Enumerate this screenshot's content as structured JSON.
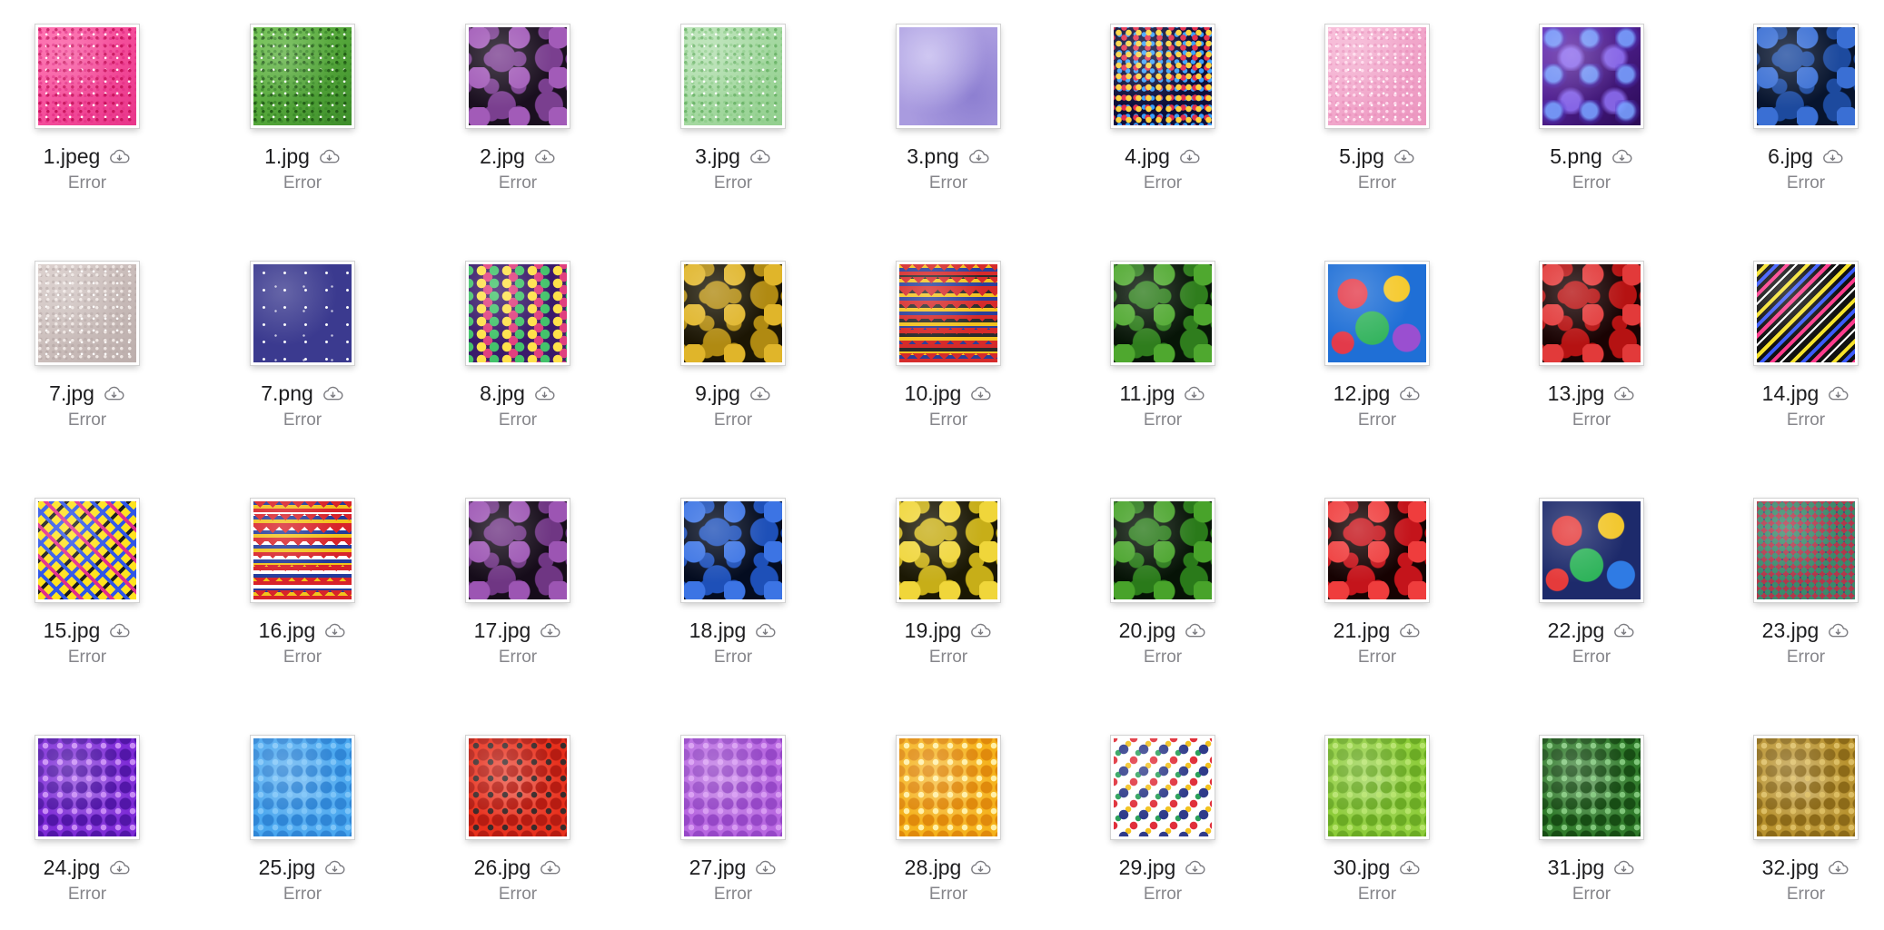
{
  "window": {
    "view": "icon-grid"
  },
  "files": [
    {
      "name": "1.jpeg",
      "status": "Error",
      "thumb": {
        "icon": "pink-glitter",
        "colors": [
          "#ff66aa",
          "#e8358a",
          "#c9155f"
        ],
        "pattern": "glitter"
      }
    },
    {
      "name": "1.jpg",
      "status": "Error",
      "thumb": {
        "icon": "green-glitter",
        "colors": [
          "#6bbf4a",
          "#3e8e2b",
          "#235f17"
        ],
        "pattern": "glitter"
      }
    },
    {
      "name": "2.jpg",
      "status": "Error",
      "thumb": {
        "icon": "purple-bokeh",
        "colors": [
          "#1a0f1f",
          "#7a3f8f",
          "#a25bb8"
        ],
        "pattern": "bokeh"
      }
    },
    {
      "name": "3.jpg",
      "status": "Error",
      "thumb": {
        "icon": "mint-glitter",
        "colors": [
          "#b9e3b6",
          "#92cf8e",
          "#6fb66c"
        ],
        "pattern": "glitter"
      }
    },
    {
      "name": "3.png",
      "status": "Error",
      "thumb": {
        "icon": "lavender-sky",
        "colors": [
          "#a99bdf",
          "#8d7fd1",
          "#c2b8ee"
        ],
        "pattern": "soft"
      }
    },
    {
      "name": "4.jpg",
      "status": "Error",
      "thumb": {
        "icon": "confetti-dots",
        "colors": [
          "#0d0f3b",
          "#ffd23c",
          "#e3304f",
          "#39a0ff"
        ],
        "pattern": "confetti"
      }
    },
    {
      "name": "5.jpg",
      "status": "Error",
      "thumb": {
        "icon": "light-pink-glitter",
        "colors": [
          "#f7b8d6",
          "#eb95bf",
          "#ffd7ea"
        ],
        "pattern": "glitter"
      }
    },
    {
      "name": "5.png",
      "status": "Error",
      "thumb": {
        "icon": "purple-bubbles",
        "colors": [
          "#2a0a55",
          "#6b2fb8",
          "#3e6bff"
        ],
        "pattern": "bubbles"
      }
    },
    {
      "name": "6.jpg",
      "status": "Error",
      "thumb": {
        "icon": "blue-bokeh",
        "colors": [
          "#07142e",
          "#1d4a9e",
          "#3a6fd4"
        ],
        "pattern": "bokeh"
      }
    },
    {
      "name": "7.jpg",
      "status": "Error",
      "thumb": {
        "icon": "silver-glitter",
        "colors": [
          "#d8ccc9",
          "#bcaeac",
          "#eee6e3"
        ],
        "pattern": "glitter"
      }
    },
    {
      "name": "7.png",
      "status": "Error",
      "thumb": {
        "icon": "night-stars",
        "colors": [
          "#3b3a8f",
          "#2d2c7a",
          "#ffffff"
        ],
        "pattern": "stars"
      }
    },
    {
      "name": "8.jpg",
      "status": "Error",
      "thumb": {
        "icon": "polka-dots",
        "colors": [
          "#3a1a6b",
          "#ffe14a",
          "#44c36b",
          "#e0407f"
        ],
        "pattern": "polka"
      }
    },
    {
      "name": "9.jpg",
      "status": "Error",
      "thumb": {
        "icon": "gold-bokeh",
        "colors": [
          "#1c1604",
          "#b08a12",
          "#e0b52a"
        ],
        "pattern": "bokeh"
      }
    },
    {
      "name": "10.jpg",
      "status": "Error",
      "thumb": {
        "icon": "zigzag-stripes",
        "colors": [
          "#d62b2b",
          "#2a3f9a",
          "#f3c21f",
          "#2b2b2b"
        ],
        "pattern": "zigzag"
      }
    },
    {
      "name": "11.jpg",
      "status": "Error",
      "thumb": {
        "icon": "green-bokeh",
        "colors": [
          "#071507",
          "#2f7d1d",
          "#4fa82f"
        ],
        "pattern": "bokeh"
      }
    },
    {
      "name": "12.jpg",
      "status": "Error",
      "thumb": {
        "icon": "rainbow-circles",
        "colors": [
          "#1f6fd6",
          "#e33a4a",
          "#f5c92b",
          "#35b45f",
          "#9a4fd0"
        ],
        "pattern": "circles"
      }
    },
    {
      "name": "13.jpg",
      "status": "Error",
      "thumb": {
        "icon": "red-bokeh",
        "colors": [
          "#1a0303",
          "#b51212",
          "#e23a3a"
        ],
        "pattern": "bokeh"
      }
    },
    {
      "name": "14.jpg",
      "status": "Error",
      "thumb": {
        "icon": "diagonal-stripes",
        "colors": [
          "#111111",
          "#f6e22b",
          "#3b5bff",
          "#ff3b8d",
          "#ffffff"
        ],
        "pattern": "diagonal"
      }
    },
    {
      "name": "15.jpg",
      "status": "Error",
      "thumb": {
        "icon": "plaid",
        "colors": [
          "#ffe31f",
          "#e02e8a",
          "#2f56e8",
          "#1b1b1b"
        ],
        "pattern": "plaid"
      }
    },
    {
      "name": "16.jpg",
      "status": "Error",
      "thumb": {
        "icon": "chevron-stripes",
        "colors": [
          "#d8232a",
          "#f2c21b",
          "#233b9c",
          "#ffffff"
        ],
        "pattern": "zigzag"
      }
    },
    {
      "name": "17.jpg",
      "status": "Error",
      "thumb": {
        "icon": "purple-bokeh",
        "colors": [
          "#160c1a",
          "#6f3683",
          "#9c55b3"
        ],
        "pattern": "bokeh"
      }
    },
    {
      "name": "18.jpg",
      "status": "Error",
      "thumb": {
        "icon": "blue-bokeh",
        "colors": [
          "#040c20",
          "#1e50b8",
          "#3c74e4"
        ],
        "pattern": "bokeh"
      }
    },
    {
      "name": "19.jpg",
      "status": "Error",
      "thumb": {
        "icon": "yellow-bokeh",
        "colors": [
          "#1b1804",
          "#c7ae18",
          "#f0d63a"
        ],
        "pattern": "bokeh"
      }
    },
    {
      "name": "20.jpg",
      "status": "Error",
      "thumb": {
        "icon": "green-bokeh",
        "colors": [
          "#061306",
          "#2a7a1a",
          "#48a32a"
        ],
        "pattern": "bokeh"
      }
    },
    {
      "name": "21.jpg",
      "status": "Error",
      "thumb": {
        "icon": "red-bokeh",
        "colors": [
          "#160202",
          "#c4141b",
          "#ef3d3d"
        ],
        "pattern": "bokeh"
      }
    },
    {
      "name": "22.jpg",
      "status": "Error",
      "thumb": {
        "icon": "rainbow-balls",
        "colors": [
          "#1d2a6b",
          "#e53b3b",
          "#f2c62a",
          "#2eb35a",
          "#2f7be4"
        ],
        "pattern": "circles"
      }
    },
    {
      "name": "23.jpg",
      "status": "Error",
      "thumb": {
        "icon": "multicolor-mosaic",
        "colors": [
          "#6b5a8c",
          "#3a8b6b",
          "#b3384a",
          "#2e3d8c",
          "#d9b03a"
        ],
        "pattern": "mosaic"
      }
    },
    {
      "name": "24.jpg",
      "status": "Error",
      "thumb": {
        "icon": "purple-hearts",
        "colors": [
          "#7d2bd6",
          "#5216a8",
          "#c78af5"
        ],
        "pattern": "tiles"
      }
    },
    {
      "name": "25.jpg",
      "status": "Error",
      "thumb": {
        "icon": "blue-hexagons",
        "colors": [
          "#4aa7ef",
          "#2f86d6",
          "#7cc4f8"
        ],
        "pattern": "tiles"
      }
    },
    {
      "name": "26.jpg",
      "status": "Error",
      "thumb": {
        "icon": "red-shoes",
        "colors": [
          "#e8301c",
          "#b61c12",
          "#3a2b2b"
        ],
        "pattern": "tiles"
      }
    },
    {
      "name": "27.jpg",
      "status": "Error",
      "thumb": {
        "icon": "violet-hexagons",
        "colors": [
          "#b767e0",
          "#9647c7",
          "#d79af2"
        ],
        "pattern": "tiles"
      }
    },
    {
      "name": "28.jpg",
      "status": "Error",
      "thumb": {
        "icon": "gold-bottles",
        "colors": [
          "#f5b21c",
          "#e08a0c",
          "#fff0a8"
        ],
        "pattern": "tiles"
      }
    },
    {
      "name": "29.jpg",
      "status": "Error",
      "thumb": {
        "icon": "colorful-figures",
        "colors": [
          "#ffffff",
          "#2f3b8a",
          "#e0303a",
          "#f3c21f",
          "#2aa05a"
        ],
        "pattern": "figures"
      }
    },
    {
      "name": "30.jpg",
      "status": "Error",
      "thumb": {
        "icon": "lime-hexagons",
        "colors": [
          "#8dcc3a",
          "#6bab24",
          "#b5e36a"
        ],
        "pattern": "tiles"
      }
    },
    {
      "name": "31.jpg",
      "status": "Error",
      "thumb": {
        "icon": "green-bottles",
        "colors": [
          "#2f7a2a",
          "#174d14",
          "#7fc67a"
        ],
        "pattern": "tiles"
      }
    },
    {
      "name": "32.jpg",
      "status": "Error",
      "thumb": {
        "icon": "olive-hexagons",
        "colors": [
          "#b8922e",
          "#8c6a18",
          "#dcbd62"
        ],
        "pattern": "tiles"
      }
    }
  ]
}
